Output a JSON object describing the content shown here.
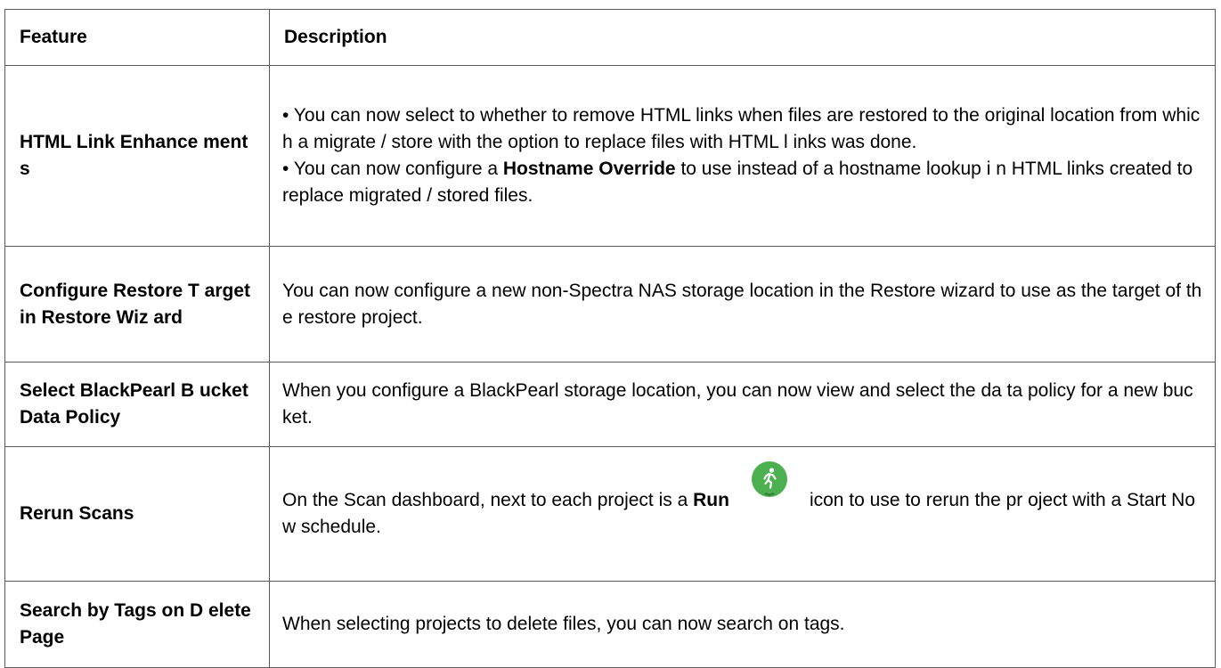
{
  "table": {
    "headers": {
      "feature": "Feature",
      "description": "Description"
    },
    "rows": [
      {
        "feature": "HTML Link Enhance ments",
        "desc1": "•  You can now select to whether to remove HTML links when files are restored to the original location from which a migrate / store with the option to replace files with HTML l inks was done.",
        "desc2_pre": "• You can now configure a ",
        "desc2_bold": "Hostname Override",
        "desc2_post": " to use instead of a hostname lookup i n HTML links created to replace migrated / stored files."
      },
      {
        "feature": "Configure Restore T arget in Restore Wiz ard",
        "desc": "You can now configure a new non-Spectra NAS storage location in the Restore wizard to use as the target of the restore project."
      },
      {
        "feature": "Select BlackPearl B ucket Data Policy",
        "desc": "When you configure a BlackPearl storage location, you can now view and select the da ta policy for a new bucket."
      },
      {
        "feature": "Rerun Scans",
        "desc_pre": "On the Scan dashboard, next to each project is a ",
        "desc_bold": "Run",
        "desc_post": "icon to use to rerun the pr oject with a Start Now schedule.",
        "icon": "running-person-icon",
        "icon_color": "#4caf50"
      },
      {
        "feature": "Search by Tags on D elete Page",
        "desc": "When selecting projects to delete files, you can now search on tags."
      }
    ]
  }
}
